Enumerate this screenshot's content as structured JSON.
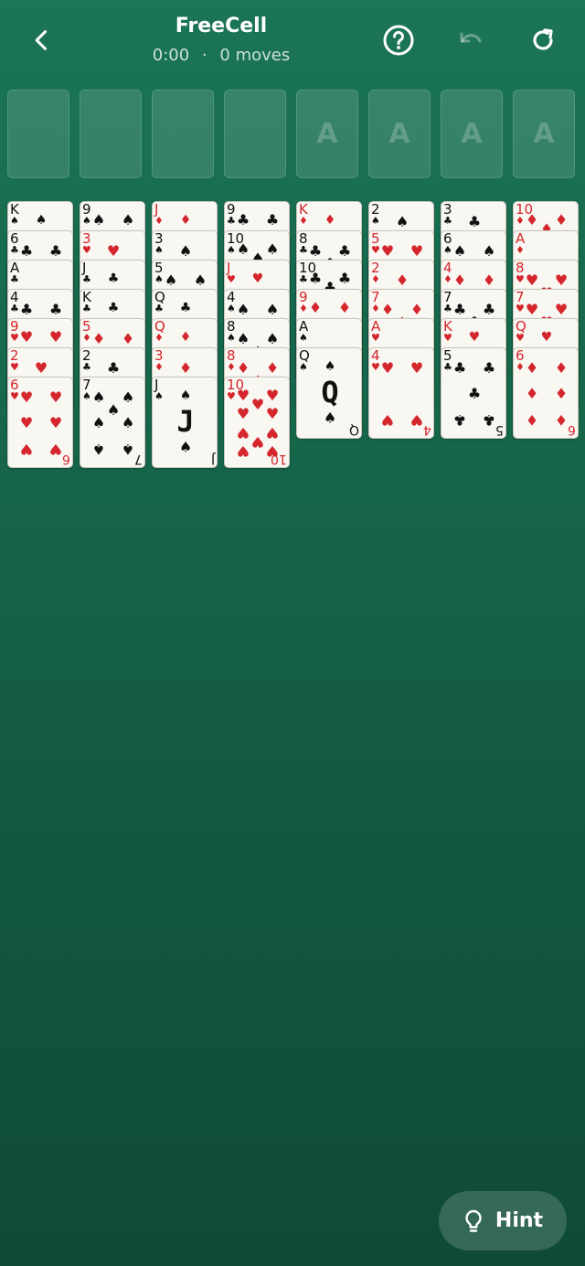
{
  "header": {
    "title": "FreeCell",
    "timer": "0:00",
    "separator": "·",
    "moves": "0 moves",
    "icons": [
      "back-icon",
      "help-icon",
      "undo-icon",
      "restart-icon"
    ]
  },
  "free_cells": [
    {
      "label": ""
    },
    {
      "label": ""
    },
    {
      "label": ""
    },
    {
      "label": ""
    }
  ],
  "foundations": [
    {
      "label": "A"
    },
    {
      "label": "A"
    },
    {
      "label": "A"
    },
    {
      "label": "A"
    }
  ],
  "columns": [
    [
      [
        "K",
        "♠"
      ],
      [
        "6",
        "♣"
      ],
      [
        "A",
        "♣"
      ],
      [
        "4",
        "♣"
      ],
      [
        "9",
        "♥"
      ],
      [
        "2",
        "♥"
      ],
      [
        "6",
        "♥"
      ]
    ],
    [
      [
        "9",
        "♠"
      ],
      [
        "3",
        "♥"
      ],
      [
        "J",
        "♣"
      ],
      [
        "K",
        "♣"
      ],
      [
        "5",
        "♦"
      ],
      [
        "2",
        "♣"
      ],
      [
        "7",
        "♠"
      ]
    ],
    [
      [
        "J",
        "♦"
      ],
      [
        "3",
        "♠"
      ],
      [
        "5",
        "♠"
      ],
      [
        "Q",
        "♣"
      ],
      [
        "Q",
        "♦"
      ],
      [
        "3",
        "♦"
      ],
      [
        "J",
        "♠"
      ]
    ],
    [
      [
        "9",
        "♣"
      ],
      [
        "10",
        "♠"
      ],
      [
        "J",
        "♥"
      ],
      [
        "4",
        "♠"
      ],
      [
        "8",
        "♠"
      ],
      [
        "8",
        "♦"
      ],
      [
        "10",
        "♥"
      ]
    ],
    [
      [
        "K",
        "♦"
      ],
      [
        "8",
        "♣"
      ],
      [
        "10",
        "♣"
      ],
      [
        "9",
        "♦"
      ],
      [
        "A",
        "♠"
      ],
      [
        "Q",
        "♠"
      ]
    ],
    [
      [
        "2",
        "♠"
      ],
      [
        "5",
        "♥"
      ],
      [
        "2",
        "♦"
      ],
      [
        "7",
        "♦"
      ],
      [
        "A",
        "♥"
      ],
      [
        "4",
        "♥"
      ]
    ],
    [
      [
        "3",
        "♣"
      ],
      [
        "6",
        "♠"
      ],
      [
        "4",
        "♦"
      ],
      [
        "7",
        "♣"
      ],
      [
        "K",
        "♥"
      ],
      [
        "5",
        "♣"
      ]
    ],
    [
      [
        "10",
        "♦"
      ],
      [
        "A",
        "♦"
      ],
      [
        "8",
        "♥"
      ],
      [
        "7",
        "♥"
      ],
      [
        "Q",
        "♥"
      ],
      [
        "6",
        "♦"
      ]
    ]
  ],
  "hint": {
    "label": "Hint",
    "icon": "lightbulb-icon"
  },
  "colors": {
    "background": "#17684c",
    "red_suit": "#d4262c",
    "black_suit": "#111111",
    "card_face": "#f8f7f2"
  }
}
